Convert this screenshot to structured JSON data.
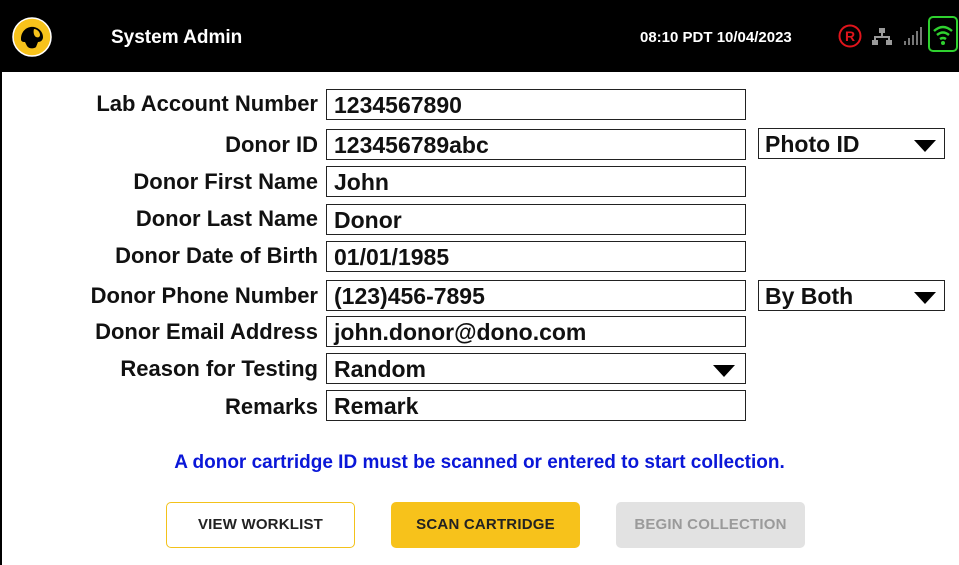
{
  "header": {
    "title": "System Admin",
    "datetime": "08:10 PDT 10/04/2023",
    "status_r_icon": "registered-r-icon",
    "status_r_color": "#e0141b",
    "network_icon": "network-icon",
    "signal_icon": "signal-bars-icon",
    "wifi_icon": "wifi-icon",
    "wifi_color": "#2fd12f",
    "logo_color": "#f7c21b"
  },
  "form": {
    "lab_account_number": {
      "label": "Lab Account Number",
      "value": "1234567890"
    },
    "donor_id": {
      "label": "Donor ID",
      "value": "123456789abc",
      "id_type": "Photo ID"
    },
    "donor_first_name": {
      "label": "Donor First Name",
      "value": "John"
    },
    "donor_last_name": {
      "label": "Donor Last Name",
      "value": "Donor"
    },
    "donor_dob": {
      "label": "Donor Date of Birth",
      "value": "01/01/1985"
    },
    "donor_phone": {
      "label": "Donor Phone Number",
      "value": "(123)456-7895",
      "contact_method": "By Both"
    },
    "donor_email": {
      "label": "Donor Email Address",
      "value": "john.donor@dono.com"
    },
    "reason_for_testing": {
      "label": "Reason for Testing",
      "value": "Random"
    },
    "remarks": {
      "label": "Remarks",
      "value": "Remark"
    }
  },
  "notice": "A donor cartridge ID must be scanned or entered to start collection.",
  "notice_color": "#0a17d8",
  "buttons": {
    "view_worklist": "VIEW WORKLIST",
    "scan_cartridge": "SCAN CARTRIDGE",
    "begin_collection": "BEGIN COLLECTION",
    "accent_color": "#f7c21b",
    "disabled_color": "#e2e2e2"
  }
}
